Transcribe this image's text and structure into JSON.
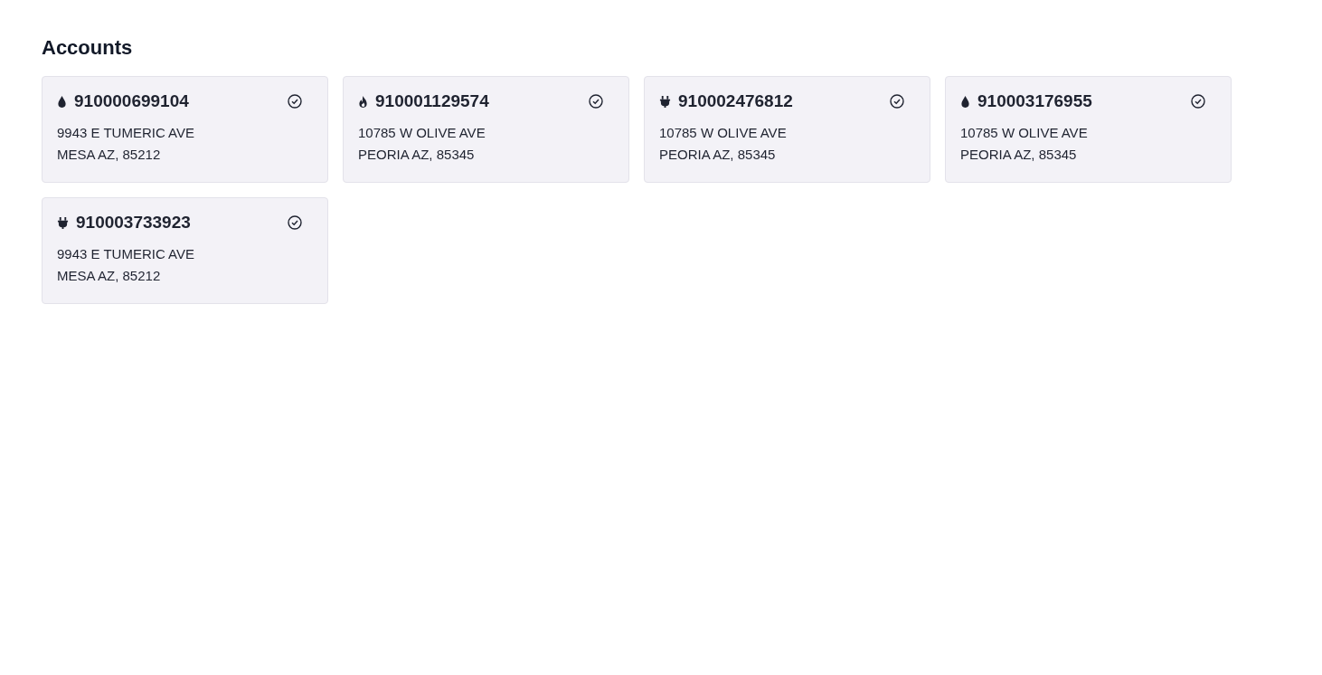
{
  "title": "Accounts",
  "accounts": [
    {
      "kind": "water",
      "number": "910000699104",
      "street": "9943 E TUMERIC AVE",
      "city": "MESA AZ, 85212"
    },
    {
      "kind": "gas",
      "number": "910001129574",
      "street": "10785 W OLIVE AVE",
      "city": "PEORIA AZ, 85345"
    },
    {
      "kind": "electric",
      "number": "910002476812",
      "street": "10785 W OLIVE AVE",
      "city": "PEORIA AZ, 85345"
    },
    {
      "kind": "water",
      "number": "910003176955",
      "street": "10785 W OLIVE AVE",
      "city": "PEORIA AZ, 85345"
    },
    {
      "kind": "electric",
      "number": "910003733923",
      "street": "9943 E TUMERIC AVE",
      "city": "MESA AZ, 85212"
    }
  ]
}
